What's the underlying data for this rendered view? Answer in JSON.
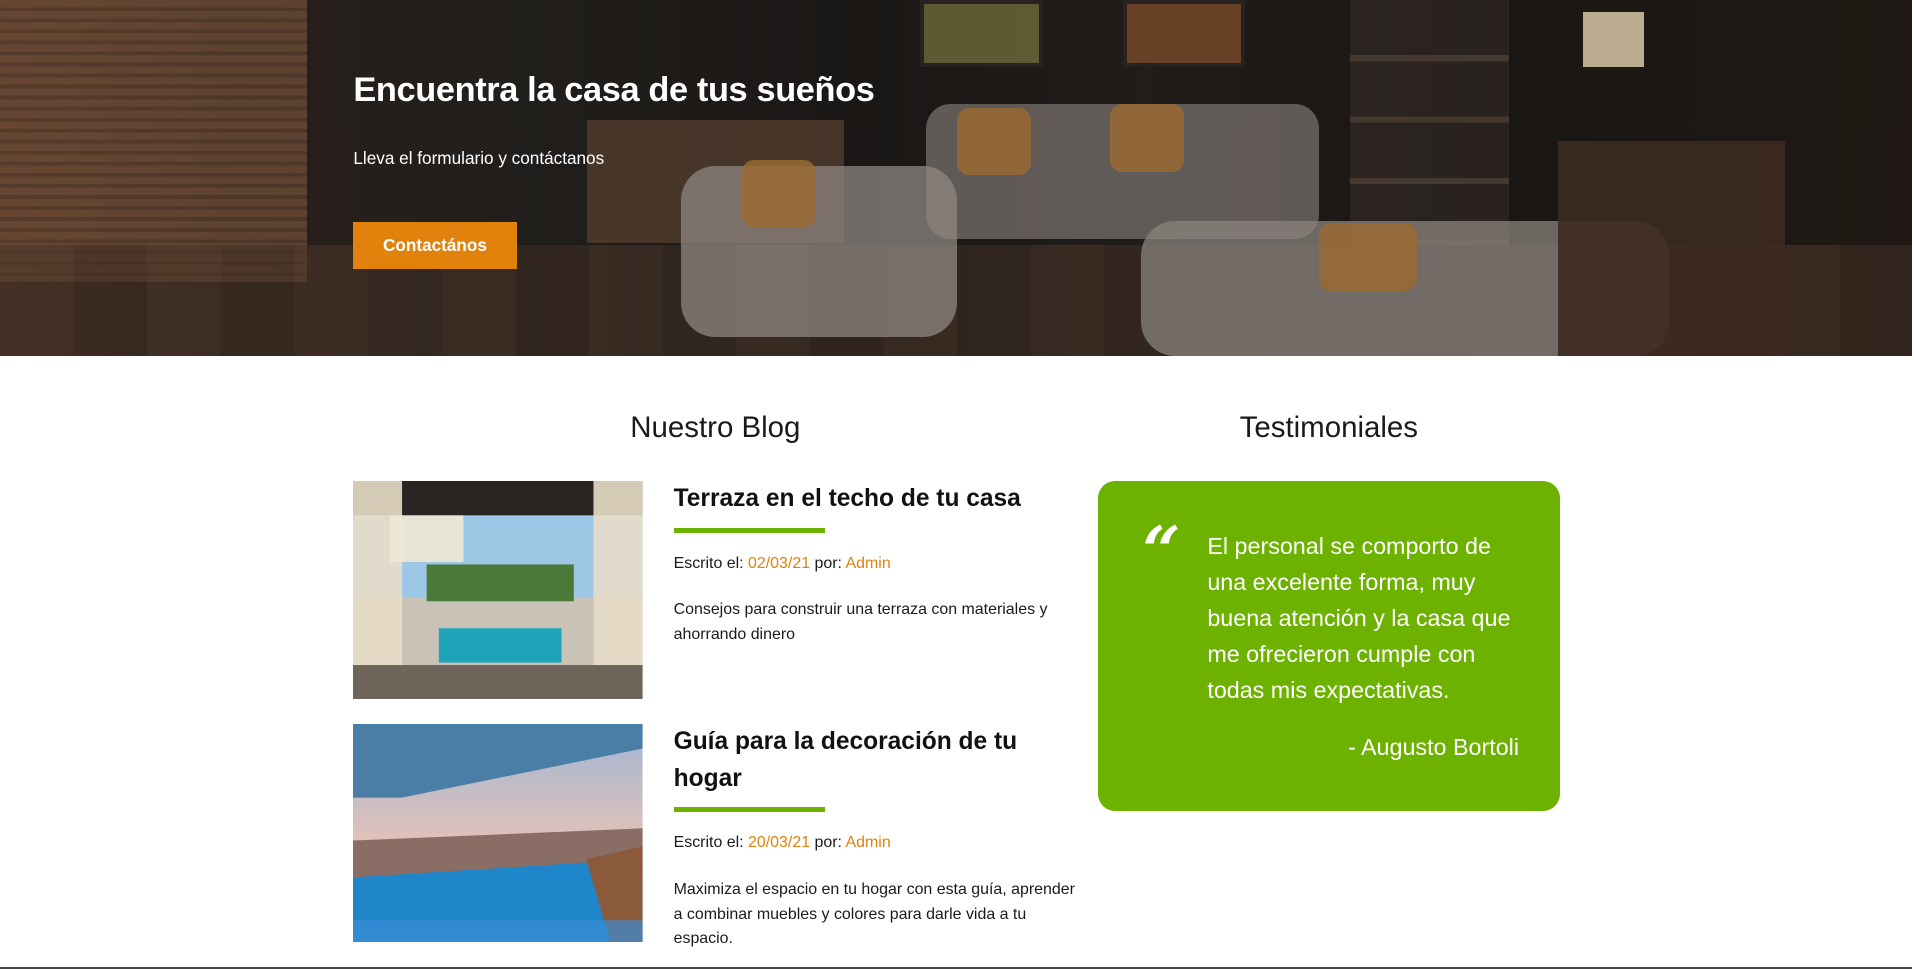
{
  "hero": {
    "title": "Encuentra la casa de tus sueños",
    "subtitle": "Lleva el formulario y contáctanos",
    "button_label": "Contactános"
  },
  "blog": {
    "title": "Nuestro Blog",
    "posts": [
      {
        "title": "Terraza en el techo de tu casa",
        "meta_prefix": "Escrito el: ",
        "date": "02/03/21",
        "by": " por: ",
        "author": "Admin",
        "excerpt": "Consejos para construir una terraza con materiales y ahorrando dinero"
      },
      {
        "title": "Guía para la decoración de tu hogar",
        "meta_prefix": "Escrito el: ",
        "date": "20/03/21",
        "by": " por: ",
        "author": "Admin",
        "excerpt": "Maximiza el espacio en tu hogar con esta guía, aprender a combinar muebles y colores para darle vida a tu espacio."
      }
    ]
  },
  "testimonials": {
    "title": "Testimoniales",
    "quote_mark": "“",
    "text": "El personal se comporto de una excelente forma, muy buena atención y la casa que me ofrecieron cumple con todas mis expectativas.",
    "author": "- Augusto Bortoli"
  },
  "colors": {
    "accent_orange": "#e0820c",
    "accent_green": "#6db200"
  }
}
